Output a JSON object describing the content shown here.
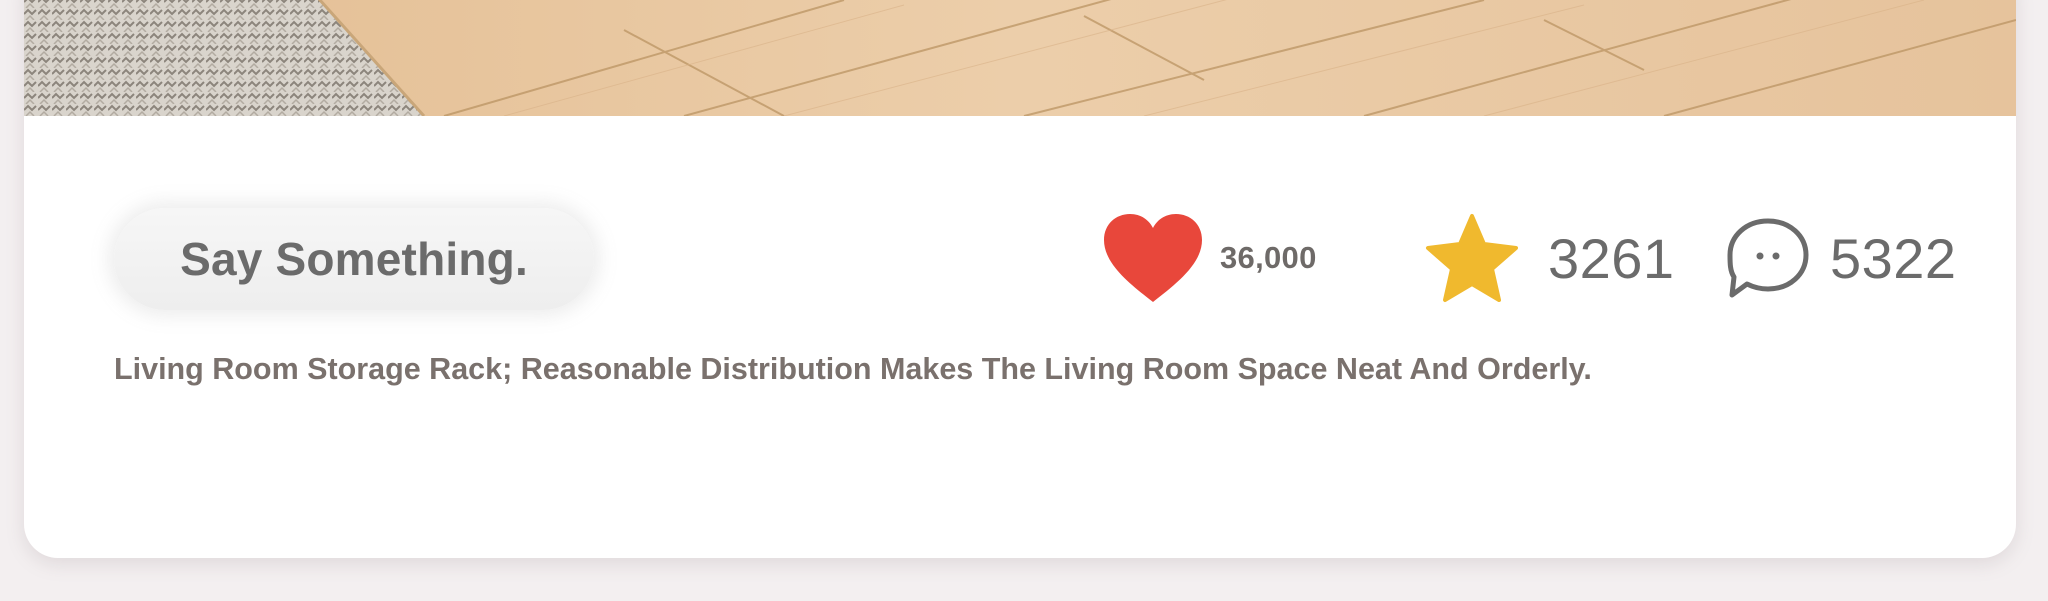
{
  "post": {
    "say_button_label": "Say Something.",
    "likes": "36,000",
    "favorites": "3261",
    "comments": "5322",
    "description": "Living Room Storage Rack; Reasonable Distribution Makes The Living Room Space Neat And Orderly."
  },
  "icons": {
    "like": "heart-icon",
    "favorite": "star-icon",
    "comment": "chat-bubble-icon"
  },
  "colors": {
    "heart": "#e8473b",
    "star": "#f0b92e",
    "text": "#6b6b6b",
    "description": "#7a716d",
    "page_background": "#f3eff0",
    "card_background": "#ffffff"
  }
}
